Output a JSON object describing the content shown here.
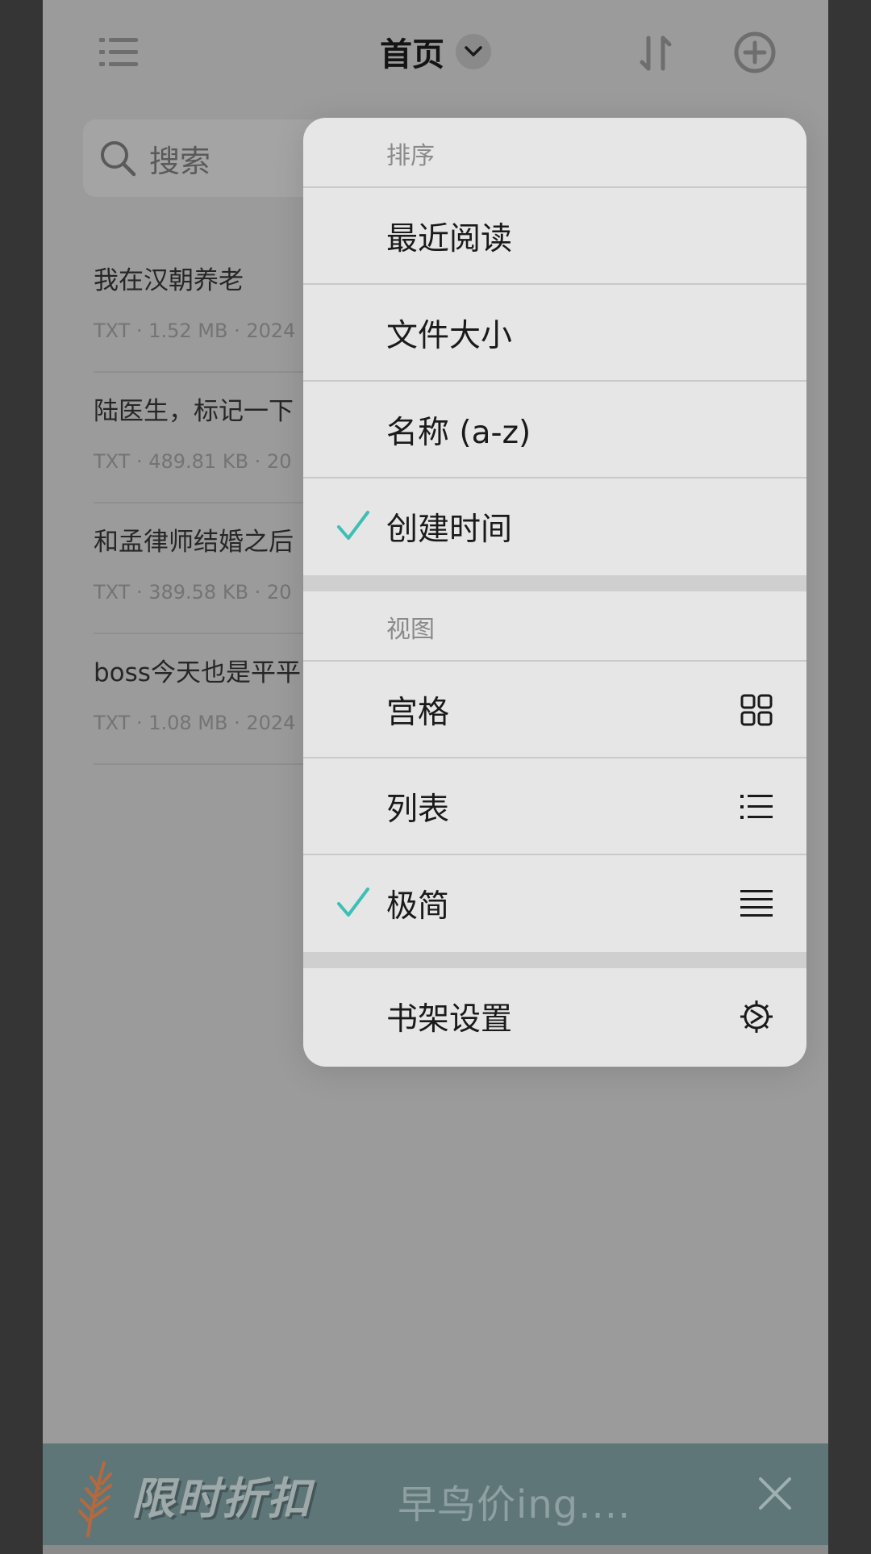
{
  "header": {
    "title": "首页",
    "menu_icon": "list-icon",
    "title_dropdown_icon": "chevron-down-icon",
    "sort_icon": "sort-icon",
    "add_icon": "plus-circle-icon"
  },
  "search": {
    "placeholder": "搜索",
    "icon": "search-icon"
  },
  "books": [
    {
      "title": "我在汉朝养老",
      "meta": "TXT · 1.52 MB · 2024"
    },
    {
      "title": "陆医生，标记一下",
      "meta": "TXT · 489.81 KB · 20"
    },
    {
      "title": "和孟律师结婚之后",
      "meta": "TXT · 389.58 KB · 20"
    },
    {
      "title": "boss今天也是平平",
      "meta": "TXT · 1.08 MB · 2024"
    }
  ],
  "popup": {
    "sort_section": {
      "header": "排序",
      "options": [
        {
          "label": "最近阅读",
          "selected": false
        },
        {
          "label": "文件大小",
          "selected": false
        },
        {
          "label": "名称 (a-z)",
          "selected": false
        },
        {
          "label": "创建时间",
          "selected": true
        }
      ]
    },
    "view_section": {
      "header": "视图",
      "options": [
        {
          "label": "宫格",
          "selected": false,
          "icon": "grid-icon"
        },
        {
          "label": "列表",
          "selected": false,
          "icon": "bulleted-list-icon"
        },
        {
          "label": "极简",
          "selected": true,
          "icon": "lines-icon"
        }
      ]
    },
    "settings": {
      "label": "书架设置",
      "icon": "gear-icon"
    }
  },
  "promo": {
    "badge": "限时折扣",
    "text": "早鸟价ing....",
    "close_icon": "close-icon",
    "leaf_icon": "leaf-icon"
  },
  "colors": {
    "check": "#3cbfb5",
    "popup_bg": "#e6e6e6",
    "overlay": "#9b9b9b",
    "promo_bg": "#5f7679"
  }
}
